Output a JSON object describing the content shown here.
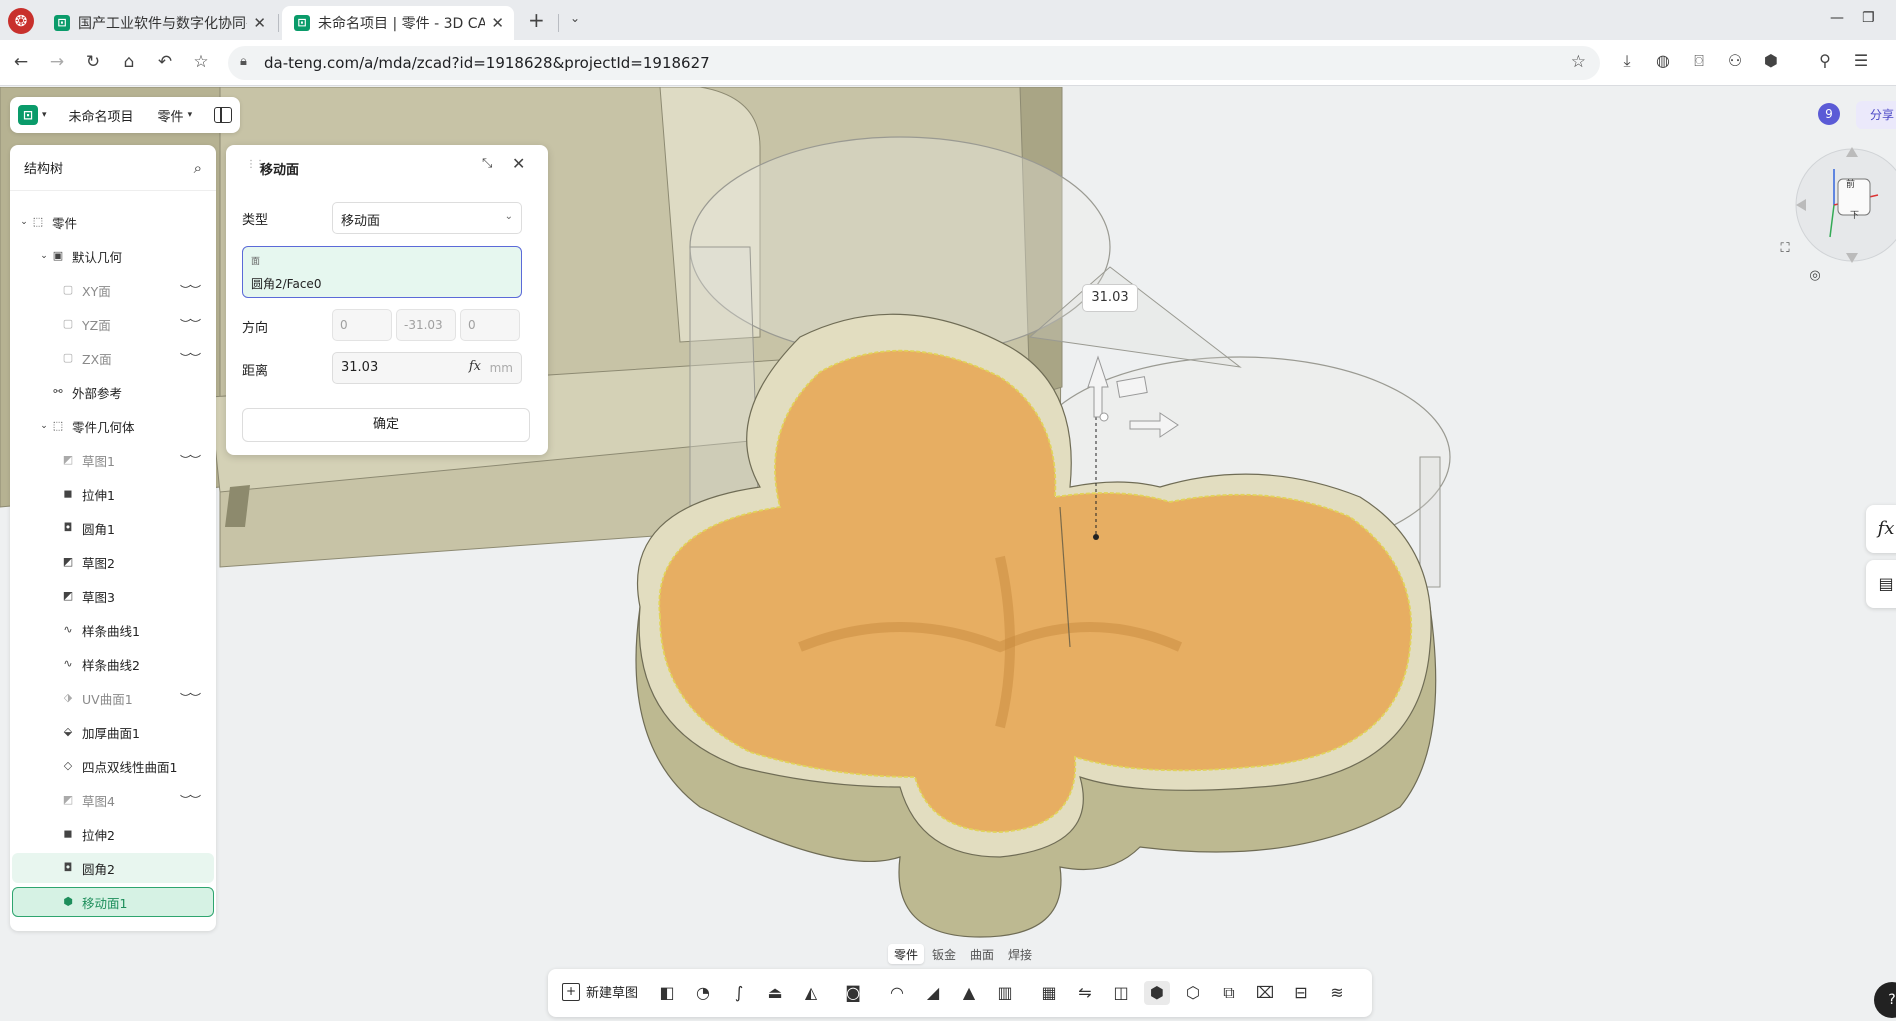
{
  "browser": {
    "tabs": [
      {
        "title": "国产工业软件与数字化协同平",
        "close": "✕"
      },
      {
        "title": "未命名项目 | 零件 - 3D CAD",
        "close": "✕"
      }
    ],
    "new_tab": "+",
    "url": "da-teng.com/a/mda/zcad?id=1918628&projectId=1918627"
  },
  "app": {
    "project_name": "未命名项目",
    "part_menu": "零件",
    "share_label": "分享",
    "badge_count": "9"
  },
  "tree": {
    "title": "结构树",
    "items": [
      {
        "label": "零件",
        "icon": "part-icon"
      },
      {
        "label": "默认几何",
        "icon": "default-geometry-icon"
      },
      {
        "label": "XY面",
        "icon": "plane-icon"
      },
      {
        "label": "YZ面",
        "icon": "plane-icon"
      },
      {
        "label": "ZX面",
        "icon": "plane-icon"
      },
      {
        "label": "外部参考",
        "icon": "external-ref-icon"
      },
      {
        "label": "零件几何体",
        "icon": "part-body-icon"
      },
      {
        "label": "草图1",
        "icon": "sketch-icon"
      },
      {
        "label": "拉伸1",
        "icon": "extrude-icon"
      },
      {
        "label": "圆角1",
        "icon": "fillet-icon"
      },
      {
        "label": "草图2",
        "icon": "sketch-icon"
      },
      {
        "label": "草图3",
        "icon": "sketch-icon"
      },
      {
        "label": "样条曲线1",
        "icon": "spline-icon"
      },
      {
        "label": "样条曲线2",
        "icon": "spline-icon"
      },
      {
        "label": "UV曲面1",
        "icon": "uv-surface-icon"
      },
      {
        "label": "加厚曲面1",
        "icon": "thicken-icon"
      },
      {
        "label": "四点双线性曲面1",
        "icon": "bilinear-surface-icon"
      },
      {
        "label": "草图4",
        "icon": "sketch-icon"
      },
      {
        "label": "拉伸2",
        "icon": "extrude-icon"
      },
      {
        "label": "圆角2",
        "icon": "fillet-icon"
      },
      {
        "label": "移动面1",
        "icon": "move-face-icon"
      }
    ]
  },
  "dialog": {
    "title": "移动面",
    "type_label": "类型",
    "type_value": "移动面",
    "face_caption": "面",
    "face_value": "圆角2/Face0",
    "direction_label": "方向",
    "direction": [
      "0",
      "-31.03",
      "0"
    ],
    "distance_label": "距离",
    "distance_value": "31.03",
    "distance_fx": "fx",
    "distance_unit": "mm",
    "confirm_label": "确定"
  },
  "viewport": {
    "dimension_label": "31.03",
    "viewcube_labels": [
      "前",
      "下"
    ]
  },
  "mode_tabs": [
    "零件",
    "钣金",
    "曲面",
    "焊接"
  ],
  "toolbar": {
    "new_sketch_label": "新建草图"
  },
  "side": {
    "fx_label": "fx"
  },
  "colors": {
    "accent": "#0a9b6a",
    "selection_face": "#e8a858",
    "model_body": "#c9c6a4",
    "share": "#4a47c6"
  }
}
